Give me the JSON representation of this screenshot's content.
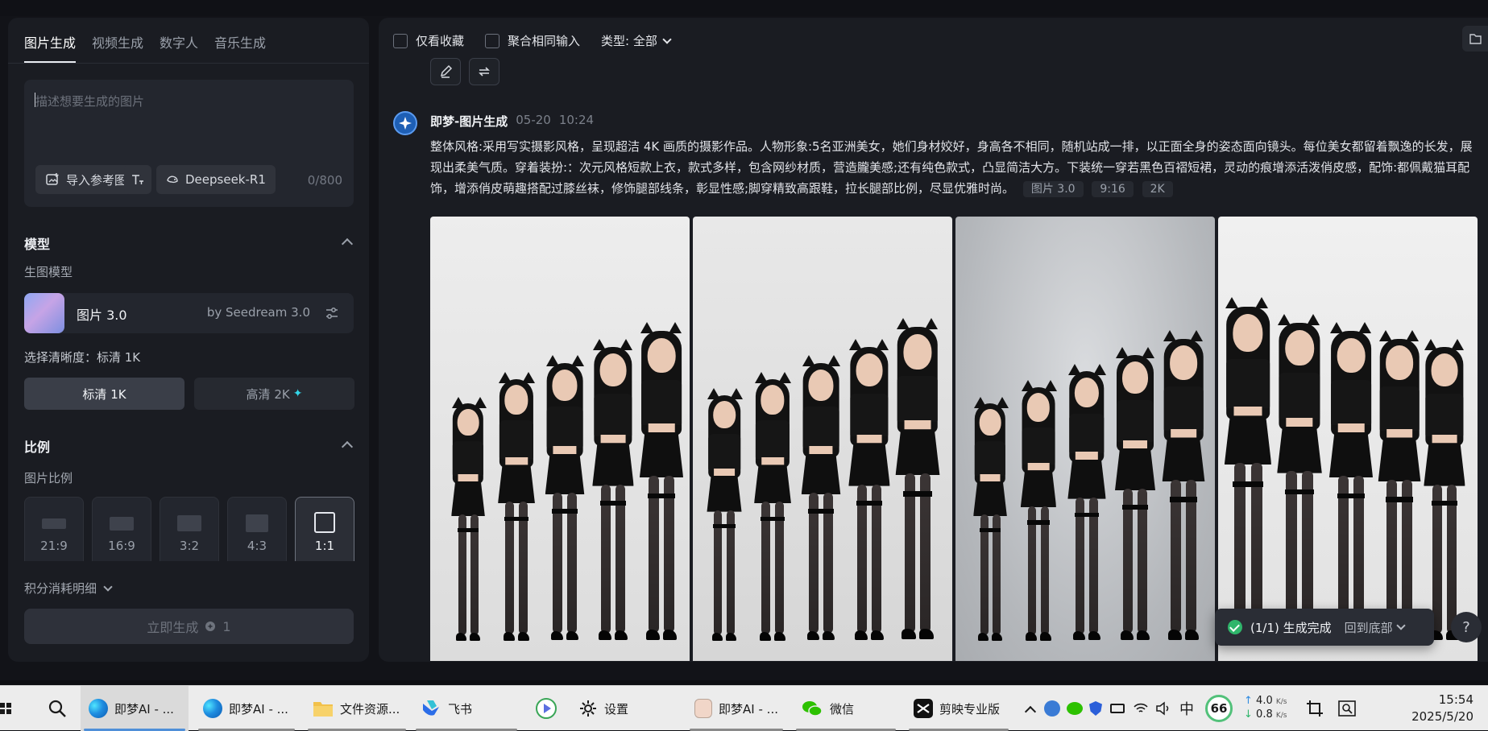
{
  "left_panel": {
    "tabs": [
      "图片生成",
      "视频生成",
      "数字人",
      "音乐生成"
    ],
    "prompt_placeholder": "描述想要生成的图片",
    "import_ref_label": "导入参考图",
    "model_chip_label": "Deepseek-R1",
    "char_counter": "0/800",
    "model_section_title": "模型",
    "gen_model_label": "生图模型",
    "model_name": "图片 3.0",
    "model_by": "by Seedream 3.0",
    "resolution_label": "选择清晰度：标清 1K",
    "res_standard": "标清 1K",
    "res_high": "高清 2K",
    "ratio_section_title": "比例",
    "ratio_sub_label": "图片比例",
    "ratios": [
      "21:9",
      "16:9",
      "3:2",
      "4:3",
      "1:1"
    ],
    "selected_ratio": "1:1",
    "points_detail": "积分消耗明细",
    "generate_label": "立即生成",
    "generate_cost": "1"
  },
  "right_panel": {
    "filter_favorites": "仅看收藏",
    "filter_merge": "聚合相同输入",
    "filter_type": "类型: 全部",
    "message": {
      "app_name": "即梦-图片生成",
      "date": "05-20",
      "time": "10:24",
      "prompt": "整体风格:采用写实摄影风格，呈现超洁 4K 画质的摄影作品。人物形象:5名亚洲美女，她们身材姣好，身高各不相同，随机站成一排，以正面全身的姿态面向镜头。每位美女都留着飘逸的长发，展现出柔美气质。穿着装扮:：次元风格短款上衣，款式多样，包含网纱材质，营造朧美感;还有纯色款式，凸显简洁大方。下装统一穿若黑色百褶短裙，灵动的痕增添活泼俏皮感，配饰:都佩戴猫耳配饰，增添俏皮萌趣搭配过膝丝袜，修饰腿部线条，彰显性感;脚穿精致高跟鞋，拉长腿部比例，尽显优雅时尚。",
      "tags": [
        "图片 3.0",
        "9:16",
        "2K"
      ]
    },
    "toast_status": "(1/1) 生成完成",
    "toast_back": "回到底部",
    "help_label": "?"
  },
  "taskbar": {
    "items": [
      {
        "label": "即梦AI - ...",
        "active": true
      },
      {
        "label": "即梦AI - ...",
        "active": false
      },
      {
        "label": "文件资源...",
        "active": false
      },
      {
        "label": "飞书",
        "active": false
      },
      {
        "label": "",
        "active": false
      },
      {
        "label": "设置",
        "active": false
      },
      {
        "label": "即梦AI - ...",
        "active": false
      },
      {
        "label": "微信",
        "active": false
      },
      {
        "label": "剪映专业版",
        "active": false
      }
    ],
    "ime": "中",
    "badge": "66",
    "net_up": "4.0",
    "net_down": "0.8",
    "net_unit": "K/s",
    "time": "15:54",
    "date": "2025/5/20"
  },
  "colors": {
    "accent_blue": "#5b9bf0",
    "success_green": "#2fb56b",
    "panel_bg": "#1a1c22"
  }
}
